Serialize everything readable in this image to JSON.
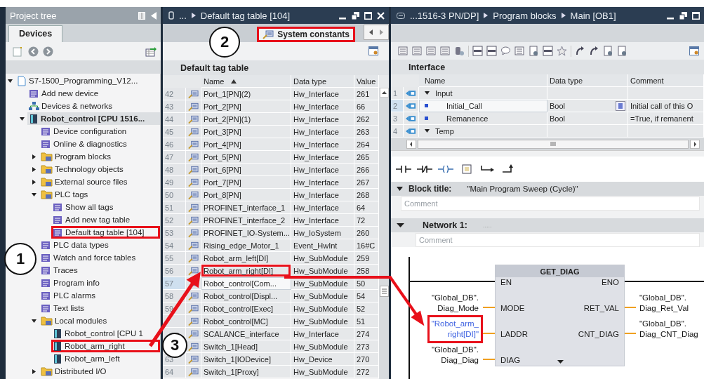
{
  "project_tree": {
    "title": "Project tree",
    "tabs": [
      {
        "label": "Devices",
        "selected": true
      }
    ],
    "items": [
      {
        "label": "S7-1500_Programming_V12...",
        "kind": "document",
        "expanded": true,
        "selected": false,
        "highlighted": false,
        "children": [
          {
            "label": "Add new device",
            "kind": "item",
            "selected": false,
            "highlighted": false
          },
          {
            "label": "Devices & networks",
            "kind": "network",
            "selected": false,
            "highlighted": false
          },
          {
            "label": "Robot_control [CPU 1516...",
            "kind": "device",
            "expanded": true,
            "selected": true,
            "highlighted": false,
            "children": [
              {
                "label": "Device configuration",
                "kind": "item",
                "selected": false,
                "highlighted": false
              },
              {
                "label": "Online & diagnostics",
                "kind": "item",
                "selected": false,
                "highlighted": false
              },
              {
                "label": "Program blocks",
                "kind": "folder",
                "expanded": false,
                "selected": false,
                "highlighted": false
              },
              {
                "label": "Technology objects",
                "kind": "folder",
                "expanded": false,
                "selected": false,
                "highlighted": false
              },
              {
                "label": "External source files",
                "kind": "folder",
                "expanded": false,
                "selected": false,
                "highlighted": false
              },
              {
                "label": "PLC tags",
                "kind": "folder",
                "expanded": true,
                "selected": false,
                "highlighted": false,
                "children": [
                  {
                    "label": "Show all tags",
                    "kind": "item",
                    "selected": false,
                    "highlighted": false
                  },
                  {
                    "label": "Add new tag table",
                    "kind": "item",
                    "selected": false,
                    "highlighted": false
                  },
                  {
                    "label": "Default tag table [104]",
                    "kind": "item",
                    "selected": false,
                    "highlighted": true
                  }
                ]
              },
              {
                "label": "PLC data types",
                "kind": "item",
                "selected": false,
                "highlighted": false
              },
              {
                "label": "Watch and force tables",
                "kind": "item",
                "selected": false,
                "highlighted": false
              },
              {
                "label": "Traces",
                "kind": "item",
                "selected": false,
                "highlighted": false
              },
              {
                "label": "Program info",
                "kind": "item",
                "selected": false,
                "highlighted": false
              },
              {
                "label": "PLC alarms",
                "kind": "item",
                "selected": false,
                "highlighted": false
              },
              {
                "label": "Text lists",
                "kind": "item",
                "selected": false,
                "highlighted": false
              },
              {
                "label": "Local modules",
                "kind": "folder",
                "expanded": true,
                "selected": false,
                "highlighted": false,
                "children": [
                  {
                    "label": "Robot_control [CPU 1",
                    "kind": "module",
                    "selected": false,
                    "highlighted": false
                  },
                  {
                    "label": "Robot_arm_right",
                    "kind": "module",
                    "selected": false,
                    "highlighted": true
                  },
                  {
                    "label": "Robot_arm_left",
                    "kind": "module",
                    "selected": false,
                    "highlighted": false
                  }
                ]
              },
              {
                "label": "Distributed I/O",
                "kind": "folder",
                "expanded": false,
                "selected": false,
                "highlighted": false
              }
            ]
          }
        ]
      }
    ]
  },
  "tag_editor": {
    "breadcrumb": [
      "...",
      "Default tag table [104]"
    ],
    "tabs": [
      {
        "label": "System constants",
        "selected": true,
        "highlighted": true
      }
    ],
    "table_title": "Default tag table",
    "columns": [
      "Name",
      "Data type",
      "Value"
    ],
    "rows": [
      {
        "number": "42",
        "name": "Port_1[PN](2)",
        "data_type": "Hw_Interface",
        "value": "261",
        "selected": false,
        "highlighted": false
      },
      {
        "number": "43",
        "name": "Port_2[PN]",
        "data_type": "Hw_Interface",
        "value": "66",
        "selected": false,
        "highlighted": false
      },
      {
        "number": "44",
        "name": "Port_2[PN](1)",
        "data_type": "Hw_Interface",
        "value": "262",
        "selected": false,
        "highlighted": false
      },
      {
        "number": "45",
        "name": "Port_3[PN]",
        "data_type": "Hw_Interface",
        "value": "263",
        "selected": false,
        "highlighted": false
      },
      {
        "number": "46",
        "name": "Port_4[PN]",
        "data_type": "Hw_Interface",
        "value": "264",
        "selected": false,
        "highlighted": false
      },
      {
        "number": "47",
        "name": "Port_5[PN]",
        "data_type": "Hw_Interface",
        "value": "265",
        "selected": false,
        "highlighted": false
      },
      {
        "number": "48",
        "name": "Port_6[PN]",
        "data_type": "Hw_Interface",
        "value": "266",
        "selected": false,
        "highlighted": false
      },
      {
        "number": "49",
        "name": "Port_7[PN]",
        "data_type": "Hw_Interface",
        "value": "267",
        "selected": false,
        "highlighted": false
      },
      {
        "number": "50",
        "name": "Port_8[PN]",
        "data_type": "Hw_Interface",
        "value": "268",
        "selected": false,
        "highlighted": false
      },
      {
        "number": "51",
        "name": "PROFINET_interface_1",
        "data_type": "Hw_Interface",
        "value": "64",
        "selected": false,
        "highlighted": false
      },
      {
        "number": "52",
        "name": "PROFINET_interface_2",
        "data_type": "Hw_Interface",
        "value": "72",
        "selected": false,
        "highlighted": false
      },
      {
        "number": "53",
        "name": "PROFINET_IO-System...",
        "data_type": "Hw_IoSystem",
        "value": "260",
        "selected": false,
        "highlighted": false
      },
      {
        "number": "54",
        "name": "Rising_edge_Motor_1",
        "data_type": "Event_HwInt",
        "value": "16#C",
        "selected": false,
        "highlighted": false
      },
      {
        "number": "55",
        "name": "Robot_arm_left[DI]",
        "data_type": "Hw_SubModule",
        "value": "259",
        "selected": false,
        "highlighted": false
      },
      {
        "number": "56",
        "name": "Robot_arm_right[DI]",
        "data_type": "Hw_SubModule",
        "value": "258",
        "selected": false,
        "highlighted": true
      },
      {
        "number": "57",
        "name": "Robot_control[Com...",
        "data_type": "Hw_SubModule",
        "value": "50",
        "selected": true,
        "highlighted": false
      },
      {
        "number": "58",
        "name": "Robot_control[Displ...",
        "data_type": "Hw_SubModule",
        "value": "54",
        "selected": false,
        "highlighted": false
      },
      {
        "number": "59",
        "name": "Robot_control[Exec]",
        "data_type": "Hw_SubModule",
        "value": "52",
        "selected": false,
        "highlighted": false
      },
      {
        "name": "Robot_control[MC]",
        "data_type": "Hw_SubModule",
        "value": "51",
        "selected": false,
        "highlighted": false
      },
      {
        "name": "SCALANCE_interface",
        "data_type": "Hw_Interface",
        "value": "274",
        "selected": false,
        "highlighted": false
      },
      {
        "name": "Switch_1[Head]",
        "data_type": "Hw_SubModule",
        "value": "273",
        "selected": false,
        "highlighted": false
      },
      {
        "number": "63",
        "name": "Switch_1[IODevice]",
        "data_type": "Hw_Device",
        "value": "270",
        "selected": false,
        "highlighted": false
      },
      {
        "number": "64",
        "name": "Switch_1[Proxy]",
        "data_type": "Hw_SubModule",
        "value": "272",
        "selected": false,
        "highlighted": false
      }
    ]
  },
  "program_editor": {
    "breadcrumb": [
      "...1516-3 PN/DP]",
      "Program blocks",
      "Main [OB1]"
    ],
    "interface": {
      "title": "Interface",
      "columns": [
        "Name",
        "Data type",
        "Comment"
      ],
      "rows": [
        {
          "number": "1",
          "kind": "section",
          "name": "Input",
          "expanded": true,
          "selected": false
        },
        {
          "number": "2",
          "kind": "member",
          "name": "Initial_Call",
          "data_type": "Bool",
          "comment": "Initial call of this O",
          "selected": true
        },
        {
          "number": "3",
          "kind": "member",
          "name": "Remanence",
          "data_type": "Bool",
          "comment": "=True, if remanent",
          "selected": false
        },
        {
          "number": "4",
          "kind": "section",
          "name": "Temp",
          "expanded": true,
          "selected": false
        }
      ]
    },
    "block_title": {
      "label": "Block title:",
      "value": "\"Main Program Sweep (Cycle)\"",
      "comment_placeholder": "Comment",
      "expanded": true
    },
    "network": {
      "label": "Network 1:",
      "title": ".....",
      "comment_placeholder": "Comment",
      "expanded": true,
      "block": {
        "name": "GET_DIAG",
        "inputs": [
          {
            "pin": "EN"
          },
          {
            "pin": "MODE",
            "operand": "\"Global_DB\".\nDiag_Mode",
            "kind": "tag",
            "highlighted": false
          },
          {
            "pin": "LADDR",
            "operand": "\"Robot_arm_\nright[DI]\"",
            "kind": "constant",
            "highlighted": true
          },
          {
            "pin": "DIAG",
            "operand": "\"Global_DB\".\nDiag_Diag",
            "kind": "tag",
            "highlighted": false
          }
        ],
        "outputs": [
          {
            "pin": "ENO"
          },
          {
            "pin": "RET_VAL",
            "operand": "\"Global_DB\".\nDiag_Ret_Val",
            "kind": "tag",
            "highlighted": false
          },
          {
            "pin": "CNT_DIAG",
            "operand": "\"Global_DB\".\nDiag_CNT_Diag",
            "kind": "tag",
            "highlighted": false
          }
        ]
      }
    }
  },
  "callouts": [
    "1",
    "2",
    "3"
  ]
}
